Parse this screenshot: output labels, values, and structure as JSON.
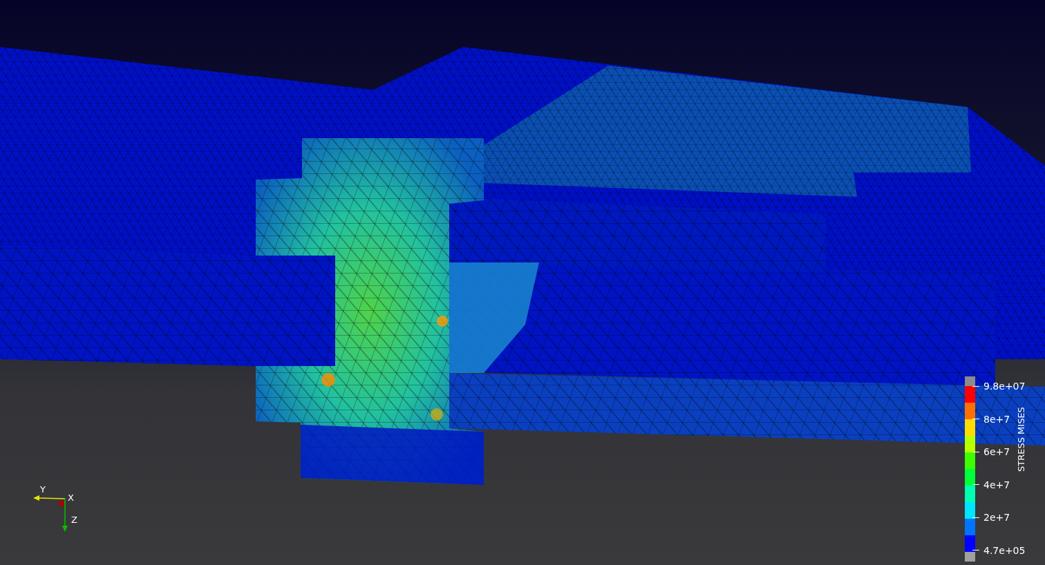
{
  "render_view": {
    "orientation_axes": {
      "labels": [
        "Y",
        "X",
        "Z"
      ]
    },
    "color_legend": {
      "title": "STRESS MISES",
      "bands": [
        {
          "color": "#a0a0a0"
        },
        {
          "color": "#0000ff"
        },
        {
          "color": "#0073ff"
        },
        {
          "color": "#00e5ff"
        },
        {
          "color": "#00ffb0"
        },
        {
          "color": "#00ff3a"
        },
        {
          "color": "#3cff00"
        },
        {
          "color": "#b8ff00"
        },
        {
          "color": "#ffdd00"
        },
        {
          "color": "#ff7000"
        },
        {
          "color": "#ff0000"
        },
        {
          "color": "#8c8c8c"
        }
      ],
      "ticks": [
        "9.8e+07",
        "8e+7",
        "6e+7",
        "4e+7",
        "2e+7",
        "4.7e+05"
      ]
    }
  }
}
